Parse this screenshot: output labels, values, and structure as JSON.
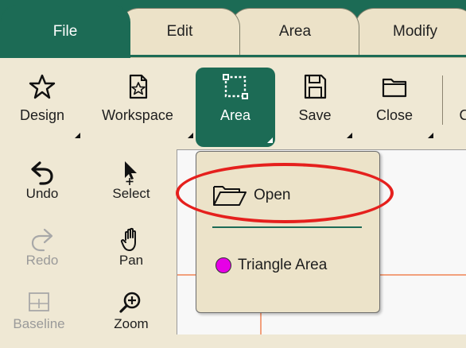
{
  "tabs": [
    {
      "label": "File",
      "active": true
    },
    {
      "label": "Edit",
      "active": false
    },
    {
      "label": "Area",
      "active": false
    },
    {
      "label": "Modify",
      "active": false
    }
  ],
  "ribbon": {
    "design_label": "Design",
    "workspace_label": "Workspace",
    "area_label": "Area",
    "save_label": "Save",
    "close_label": "Close",
    "cut_off_label": "C"
  },
  "tools": {
    "undo_label": "Undo",
    "select_label": "Select",
    "redo_label": "Redo",
    "pan_label": "Pan",
    "baseline_label": "Baseline",
    "zoom_label": "Zoom"
  },
  "area_menu": {
    "open_label": "Open",
    "triangle_area_label": "Triangle Area",
    "triangle_area_color": "#e600e6"
  },
  "colors": {
    "accent": "#1c6b55",
    "highlight_ring": "#e5201d",
    "grid_line": "#f2a07c"
  }
}
